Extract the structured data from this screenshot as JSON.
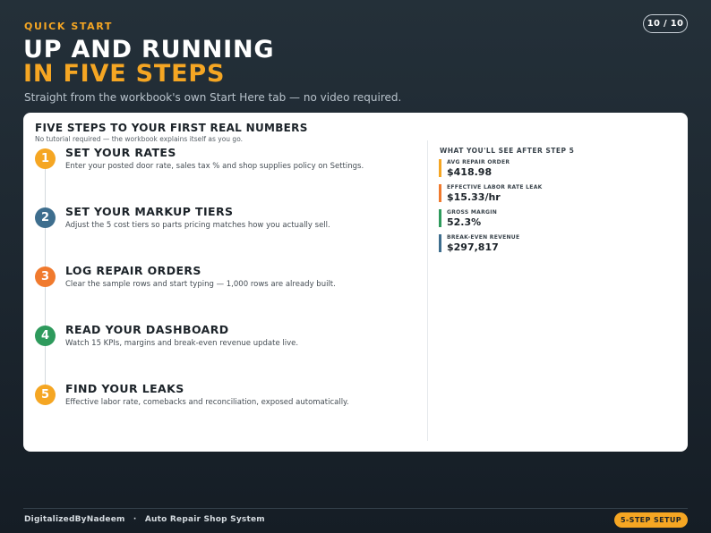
{
  "header": {
    "kicker": "QUICK START",
    "page_indicator": "10 / 10",
    "title_line1": "UP AND RUNNING",
    "title_line2": "IN FIVE STEPS",
    "subtitle": "Straight from the workbook's own Start Here tab — no video required."
  },
  "card": {
    "title": "FIVE STEPS TO YOUR FIRST REAL NUMBERS",
    "note": "No tutorial required — the workbook explains itself as you go.",
    "steps": [
      {
        "number": "1",
        "title": "SET YOUR RATES",
        "description": "Enter your posted door rate, sales tax % and shop supplies policy on Settings.",
        "color": "#f5a623"
      },
      {
        "number": "2",
        "title": "SET YOUR MARKUP TIERS",
        "description": "Adjust the 5 cost tiers so parts pricing matches how you actually sell.",
        "color": "#3e6e8e"
      },
      {
        "number": "3",
        "title": "LOG REPAIR ORDERS",
        "description": "Clear the sample rows and start typing — 1,000 rows are already built.",
        "color": "#f07a2e"
      },
      {
        "number": "4",
        "title": "READ YOUR DASHBOARD",
        "description": "Watch 15 KPIs, margins and break-even revenue update live.",
        "color": "#2e9a5c"
      },
      {
        "number": "5",
        "title": "FIND YOUR LEAKS",
        "description": "Effective labor rate, comebacks and reconciliation, exposed automatically.",
        "color": "#f5a623"
      }
    ],
    "results": {
      "heading": "WHAT YOU'LL SEE AFTER STEP 5",
      "kpis": [
        {
          "label": "AVG REPAIR ORDER",
          "value": "$418.98",
          "color": "#f5a623"
        },
        {
          "label": "EFFECTIVE LABOR RATE LEAK",
          "value": "$15.33/hr",
          "color": "#f07a2e"
        },
        {
          "label": "GROSS MARGIN",
          "value": "52.3%",
          "color": "#2e9a5c"
        },
        {
          "label": "BREAK-EVEN REVENUE",
          "value": "$297,817",
          "color": "#3e6e8e"
        }
      ]
    }
  },
  "footer": {
    "brand": "DigitalizedByNadeem",
    "separator": "·",
    "product": "Auto Repair Shop System",
    "badge": "5-STEP SETUP"
  },
  "colors": {
    "accent": "#f5a623",
    "background": "#1c262f",
    "card": "#ffffff"
  }
}
